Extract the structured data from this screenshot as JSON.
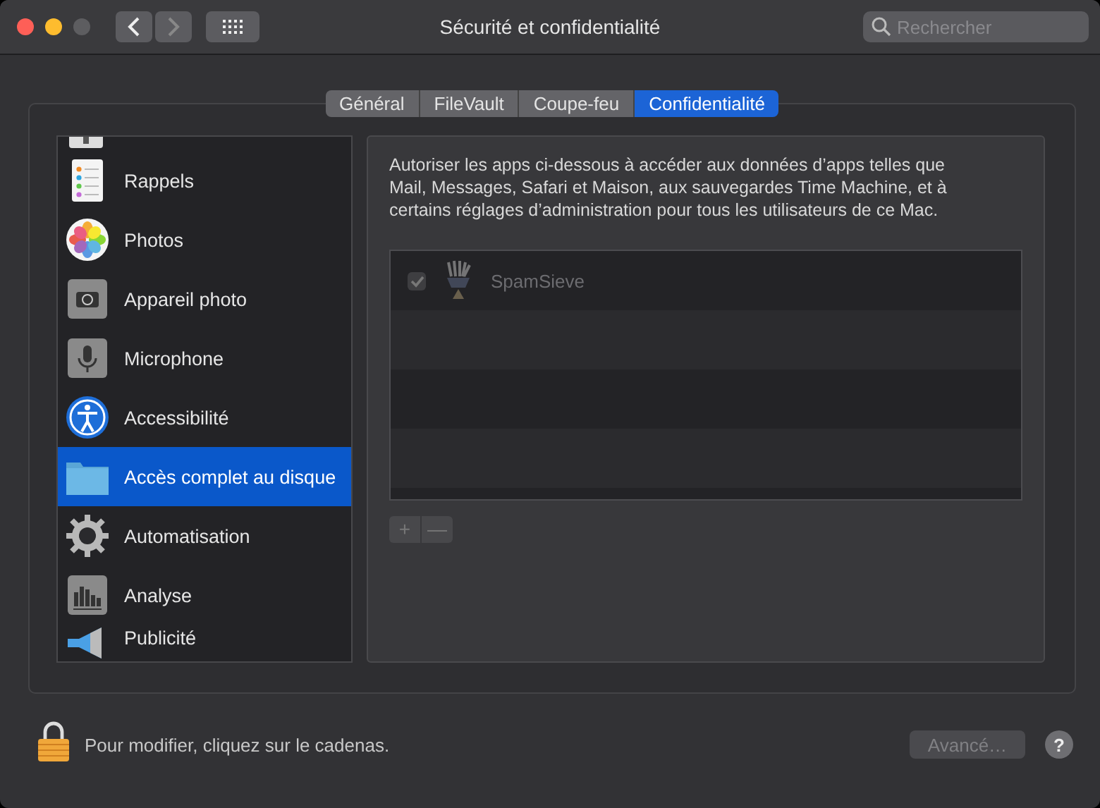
{
  "window": {
    "title": "Sécurité et confidentialité"
  },
  "search": {
    "placeholder": "Rechercher"
  },
  "tabs": [
    {
      "label": "Général",
      "selected": false
    },
    {
      "label": "FileVault",
      "selected": false
    },
    {
      "label": "Coupe-feu",
      "selected": false
    },
    {
      "label": "Confidentialité",
      "selected": true
    }
  ],
  "sidebar": {
    "items": [
      {
        "label": "Rappels",
        "selected": false
      },
      {
        "label": "Photos",
        "selected": false
      },
      {
        "label": "Appareil photo",
        "selected": false
      },
      {
        "label": "Microphone",
        "selected": false
      },
      {
        "label": "Accessibilité",
        "selected": false
      },
      {
        "label": "Accès complet au disque",
        "selected": true
      },
      {
        "label": "Automatisation",
        "selected": false
      },
      {
        "label": "Analyse",
        "selected": false
      },
      {
        "label": "Publicité",
        "selected": false
      }
    ]
  },
  "description": "Autoriser les apps ci-dessous à accéder aux données d’apps telles que Mail, Messages, Safari et Maison, aux sauvegardes Time Machine, et à certains réglages d’administration pour tous les utilisateurs de ce Mac.",
  "apps": [
    {
      "name": "SpamSieve",
      "checked": true,
      "disabled": true
    }
  ],
  "list_buttons": [
    "+",
    "—"
  ],
  "lock_message": "Pour modifier, cliquez sur le cadenas.",
  "advanced_button": {
    "label": "Avancé…",
    "disabled": true
  },
  "help_button": "?"
}
